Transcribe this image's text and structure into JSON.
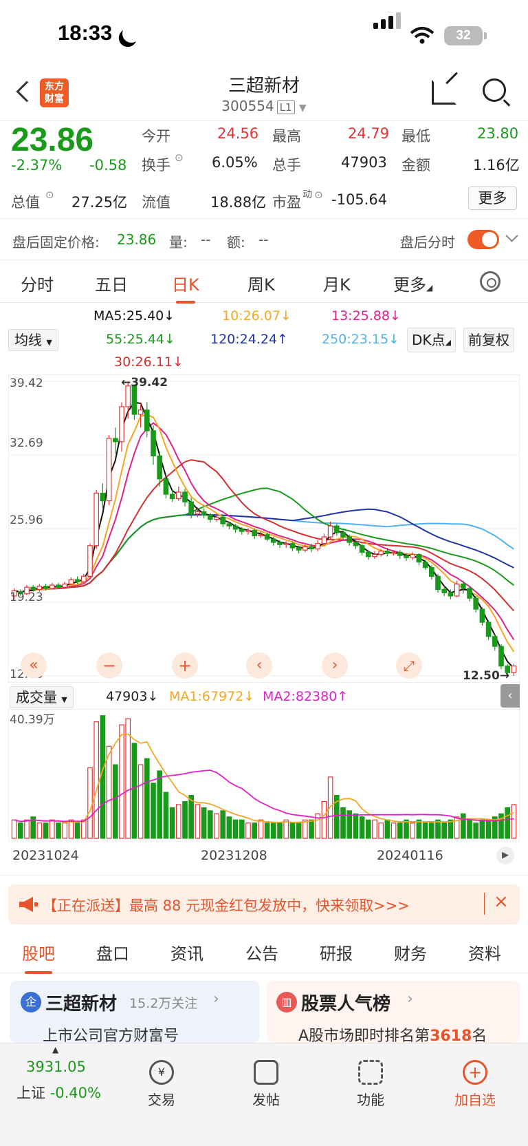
{
  "status": {
    "time": "18:33",
    "battery": "32"
  },
  "header": {
    "logo": "东方\n财富",
    "title": "三超新材",
    "code": "300554",
    "level": "L1"
  },
  "quote": {
    "price": "23.86",
    "pct": "-2.37%",
    "chg": "-0.58",
    "open_label": "今开",
    "open": "24.56",
    "high_label": "最高",
    "high": "24.79",
    "low_label": "最低",
    "low": "23.80",
    "turnover_label": "换手",
    "turnover": "6.05%",
    "vol_label": "总手",
    "vol": "47903",
    "amount_label": "金额",
    "amount": "1.16亿",
    "mcap_label": "总值",
    "mcap": "27.25亿",
    "float_label": "流值",
    "float": "18.88亿",
    "pe_label": "市盈",
    "pe_sup": "动",
    "pe": "-105.64",
    "more": "更多"
  },
  "after_hours": {
    "label": "盘后固定价格:",
    "price": "23.86",
    "vol_label": "量:",
    "vol": "--",
    "amt_label": "额:",
    "amt": "--",
    "toggle_label": "盘后分时",
    "toggle_on": true
  },
  "tabs": [
    "分时",
    "五日",
    "日K",
    "周K",
    "月K",
    "更多"
  ],
  "active_tab": "日K",
  "ma": {
    "select": "均线",
    "ma5": "MA5:25.40↓",
    "ma10": "10:26.07↓",
    "ma13": "13:25.88↓",
    "ma55": "55:25.44↓",
    "ma120": "120:24.24↑",
    "ma250": "250:23.15↓",
    "ma30": "30:26.11↓",
    "dk": "DK点",
    "adj": "前复权"
  },
  "chart_labels": {
    "y1": "39.42",
    "y2": "32.69",
    "y3": "25.96",
    "y4": "19.23",
    "y5": "12.50",
    "max": "←39.42",
    "min": "12.50→"
  },
  "volume": {
    "select": "成交量",
    "value": "47903↓",
    "ma1": "MA1:67972↓",
    "ma2": "MA2:82380↑",
    "max": "40.39万"
  },
  "dates": [
    "20231024",
    "20231208",
    "20240116"
  ],
  "colors": {
    "up": "#e53333",
    "down": "#1a9a1a",
    "accent": "#e8542a"
  },
  "chart_data": {
    "type": "candlestick",
    "ylim": [
      12.5,
      39.42
    ],
    "y_ticks": [
      39.42,
      32.69,
      25.96,
      19.23,
      12.5
    ],
    "x_labels": [
      "20231024",
      "20231208",
      "20240116"
    ],
    "candles": [
      [
        19.8,
        20.3,
        19.5,
        20.5
      ],
      [
        20.2,
        20.0,
        19.8,
        20.4
      ],
      [
        20.0,
        20.6,
        19.9,
        20.8
      ],
      [
        20.6,
        20.4,
        20.2,
        20.8
      ],
      [
        20.4,
        20.7,
        20.2,
        20.9
      ],
      [
        20.7,
        20.5,
        20.3,
        20.9
      ],
      [
        20.5,
        20.8,
        20.4,
        21.0
      ],
      [
        20.8,
        20.6,
        20.4,
        21.0
      ],
      [
        20.6,
        20.9,
        20.5,
        21.1
      ],
      [
        20.9,
        21.3,
        20.8,
        21.5
      ],
      [
        21.3,
        21.1,
        20.9,
        21.6
      ],
      [
        21.1,
        21.6,
        21.0,
        21.8
      ],
      [
        21.6,
        24.4,
        21.5,
        24.6
      ],
      [
        24.4,
        29.2,
        24.1,
        29.5
      ],
      [
        29.2,
        28.5,
        27.8,
        30.1
      ],
      [
        28.5,
        34.2,
        28.1,
        34.5
      ],
      [
        34.2,
        33.9,
        32.8,
        35.2
      ],
      [
        33.9,
        37.1,
        33.0,
        37.5
      ],
      [
        37.1,
        39.0,
        36.0,
        39.42
      ],
      [
        39.0,
        36.4,
        35.9,
        39.1
      ],
      [
        36.4,
        36.8,
        35.2,
        37.4
      ],
      [
        36.8,
        34.9,
        34.3,
        37.5
      ],
      [
        34.9,
        32.6,
        31.8,
        35.4
      ],
      [
        32.6,
        30.5,
        29.8,
        33.0
      ],
      [
        30.5,
        29.1,
        28.7,
        31.0
      ],
      [
        29.1,
        28.7,
        28.4,
        29.5
      ],
      [
        28.7,
        29.3,
        28.5,
        29.8
      ],
      [
        29.3,
        28.4,
        28.0,
        29.6
      ],
      [
        28.4,
        27.3,
        26.9,
        28.8
      ],
      [
        27.3,
        27.5,
        27.0,
        27.9
      ],
      [
        27.5,
        27.2,
        26.9,
        27.8
      ],
      [
        27.2,
        26.8,
        26.5,
        27.4
      ],
      [
        26.8,
        27.0,
        26.6,
        27.3
      ],
      [
        27.0,
        26.4,
        26.1,
        27.2
      ],
      [
        26.4,
        26.2,
        25.9,
        26.6
      ],
      [
        26.2,
        25.9,
        25.6,
        26.4
      ],
      [
        25.9,
        25.7,
        25.4,
        26.1
      ],
      [
        25.7,
        25.8,
        25.4,
        26.0
      ],
      [
        25.8,
        25.3,
        25.0,
        26.0
      ],
      [
        25.3,
        25.4,
        25.1,
        25.7
      ],
      [
        25.4,
        25.0,
        24.8,
        25.6
      ],
      [
        25.0,
        24.7,
        24.4,
        25.2
      ],
      [
        24.7,
        24.5,
        24.2,
        24.9
      ],
      [
        24.5,
        24.6,
        24.2,
        24.8
      ],
      [
        24.6,
        24.2,
        23.9,
        24.8
      ],
      [
        24.2,
        24.0,
        23.7,
        24.4
      ],
      [
        24.0,
        24.3,
        23.8,
        24.5
      ],
      [
        24.3,
        24.1,
        23.8,
        24.6
      ],
      [
        24.1,
        24.6,
        23.9,
        24.9
      ],
      [
        24.6,
        25.2,
        24.4,
        25.5
      ],
      [
        25.2,
        26.2,
        25.0,
        26.6
      ],
      [
        26.2,
        25.6,
        25.3,
        26.4
      ],
      [
        25.6,
        25.2,
        24.9,
        25.8
      ],
      [
        25.2,
        24.7,
        24.4,
        25.4
      ],
      [
        24.7,
        24.4,
        24.1,
        24.9
      ],
      [
        24.4,
        23.8,
        23.5,
        24.6
      ],
      [
        23.8,
        23.4,
        23.1,
        24.0
      ],
      [
        23.4,
        23.6,
        23.2,
        23.9
      ],
      [
        23.6,
        23.9,
        23.4,
        24.1
      ],
      [
        23.9,
        23.7,
        23.4,
        24.2
      ],
      [
        23.7,
        23.8,
        23.5,
        24.0
      ],
      [
        23.8,
        23.5,
        23.2,
        24.0
      ],
      [
        23.5,
        23.3,
        23.0,
        23.7
      ],
      [
        23.3,
        23.6,
        23.1,
        23.8
      ],
      [
        23.6,
        22.9,
        22.6,
        23.7
      ],
      [
        22.9,
        22.4,
        22.2,
        23.1
      ],
      [
        22.4,
        21.6,
        21.3,
        22.6
      ],
      [
        21.6,
        20.4,
        20.1,
        21.8
      ],
      [
        20.4,
        20.1,
        19.8,
        20.7
      ],
      [
        20.1,
        19.8,
        19.5,
        20.4
      ],
      [
        19.8,
        20.9,
        19.7,
        21.2
      ],
      [
        20.9,
        20.5,
        20.0,
        21.2
      ],
      [
        20.5,
        19.6,
        19.3,
        20.7
      ],
      [
        19.6,
        18.6,
        18.3,
        19.8
      ],
      [
        18.6,
        17.4,
        17.1,
        18.8
      ],
      [
        17.4,
        16.1,
        15.8,
        17.6
      ],
      [
        16.1,
        15.2,
        14.8,
        16.3
      ],
      [
        15.2,
        13.4,
        13.1,
        15.4
      ],
      [
        13.4,
        12.8,
        12.5,
        13.6
      ],
      [
        12.8,
        13.4,
        12.5,
        13.6
      ]
    ],
    "volumes": [
      6,
      5,
      6,
      7,
      5,
      5,
      6,
      5,
      5,
      6,
      5,
      6,
      23,
      38,
      40,
      30,
      24,
      37,
      39,
      31,
      24,
      26,
      18,
      22,
      15,
      10,
      11,
      12,
      14,
      11,
      10,
      9,
      8,
      9,
      7,
      6,
      6,
      5,
      5,
      6,
      5,
      5,
      5,
      6,
      5,
      5,
      6,
      6,
      8,
      12,
      20,
      14,
      10,
      9,
      8,
      7,
      6,
      6,
      5,
      6,
      5,
      5,
      6,
      5,
      6,
      5,
      5,
      6,
      5,
      6,
      7,
      8,
      6,
      5,
      6,
      6,
      7,
      8,
      10,
      11
    ],
    "volume_max": 40.39
  },
  "banner": {
    "text": "【正在派送】最高 88 元现金红包发放中，快来领取>>>"
  },
  "bottom_tabs": [
    "股吧",
    "盘口",
    "资讯",
    "公告",
    "研报",
    "财务",
    "资料"
  ],
  "cards": {
    "left_title": "三超新材",
    "left_follow": "15.2万关注",
    "left_sub": "上市公司官方财富号",
    "right_title": "股票人气榜",
    "right_sub_pre": "A股市场即时排名第",
    "right_rank": "3618",
    "right_sub_post": "名"
  },
  "nav": {
    "index_value": "3931.05",
    "index_name": "上证",
    "index_pct": "-0.40%",
    "trade": "交易",
    "post": "发帖",
    "func": "功能",
    "add": "加自选"
  }
}
